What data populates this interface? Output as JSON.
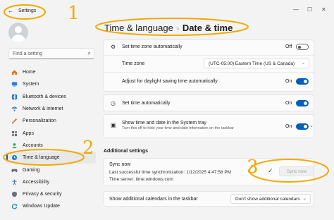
{
  "window": {
    "title": "Settings",
    "back_glyph": "←",
    "controls": {
      "minimize": "—",
      "maximize": "☐",
      "close": "✕"
    }
  },
  "sidebar": {
    "search_placeholder": "Find a setting",
    "items": [
      {
        "label": "Home",
        "icon": "home-icon",
        "color": "#e07a1f"
      },
      {
        "label": "System",
        "icon": "monitor-icon",
        "color": "#2f7bd6"
      },
      {
        "label": "Bluetooth & devices",
        "icon": "bluetooth-icon",
        "color": "#1e73c9"
      },
      {
        "label": "Network & internet",
        "icon": "wifi-icon",
        "color": "#2a6fc0"
      },
      {
        "label": "Personalization",
        "icon": "brush-icon",
        "color": "#d37a2a"
      },
      {
        "label": "Apps",
        "icon": "apps-icon",
        "color": "#6b6f7a"
      },
      {
        "label": "Accounts",
        "icon": "person-icon",
        "color": "#27a36b"
      },
      {
        "label": "Time & language",
        "icon": "globe-clock-icon",
        "color": "#1f7fd0"
      },
      {
        "label": "Gaming",
        "icon": "gamepad-icon",
        "color": "#6b6f7a"
      },
      {
        "label": "Accessibility",
        "icon": "accessibility-icon",
        "color": "#2d6fc1"
      },
      {
        "label": "Privacy & security",
        "icon": "shield-icon",
        "color": "#6b6f7a"
      },
      {
        "label": "Windows Update",
        "icon": "update-icon",
        "color": "#1f7fd0"
      }
    ],
    "active_index": 7
  },
  "header": {
    "parent": "Time & language",
    "separator": "›",
    "current": "Date & time"
  },
  "settings": {
    "set_time_zone_auto": {
      "label": "Set time zone automatically",
      "state": "Off"
    },
    "time_zone": {
      "label": "Time zone",
      "value": "(UTC-05:00) Eastern Time (US & Canada)"
    },
    "daylight_saving": {
      "label": "Adjust for daylight saving time automatically",
      "state": "On"
    },
    "set_time_auto": {
      "label": "Set time automatically",
      "state": "On"
    },
    "show_time_tray": {
      "label": "Show time and date in the System tray",
      "sub": "Turn this off to hide your time and date information on the taskbar",
      "state": "On"
    }
  },
  "additional": {
    "title": "Additional settings",
    "sync": {
      "title": "Sync now",
      "last_sync": "Last successful time synchronization: 1/12/2025 4:47:58 PM",
      "server": "Time server: time.windows.com",
      "button": "Sync now"
    },
    "calendars": {
      "label": "Show additional calendars in the taskbar",
      "value": "Don't show additional calendars"
    }
  },
  "annotations": {
    "color": "#f2a900",
    "numbers": [
      "1",
      "2",
      "3"
    ]
  }
}
